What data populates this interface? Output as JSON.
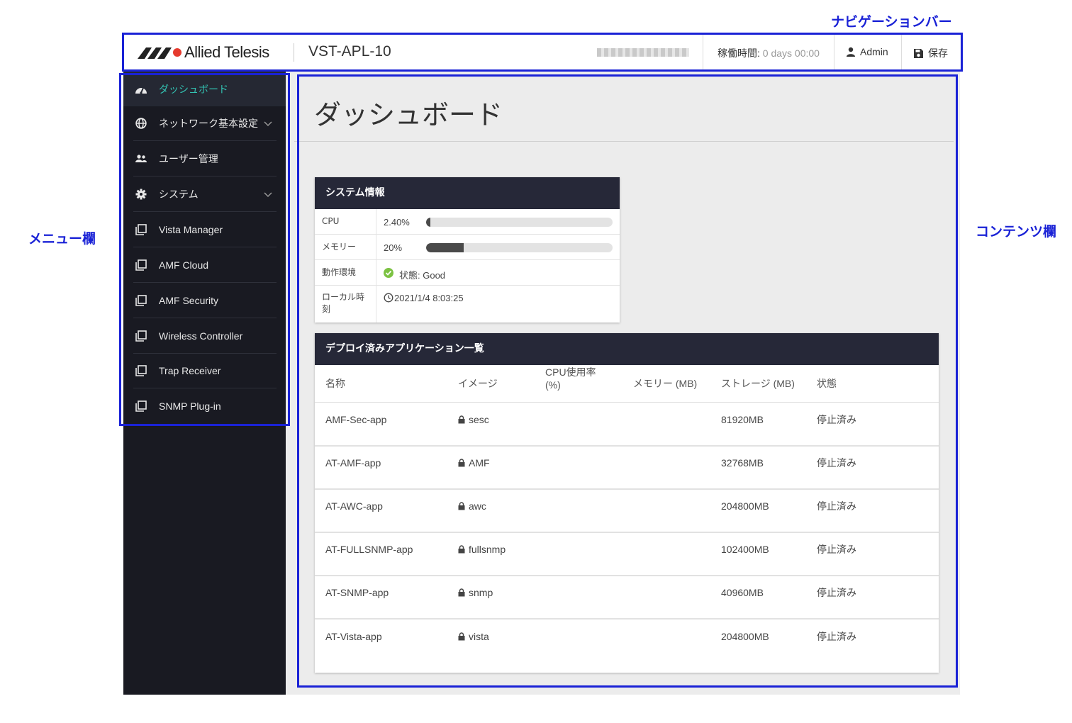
{
  "annotations": {
    "navbar_label": "ナビゲーションバー",
    "menu_label": "メニュー欄",
    "content_label": "コンテンツ欄",
    "color": "#1a22d6"
  },
  "navbar": {
    "brand": "Allied Telesis",
    "hostname": "VST-APL-10",
    "uptime_label": "稼働時間:",
    "uptime_value": " 0 days 00:00",
    "user": "Admin",
    "save": "保存"
  },
  "sidebar": {
    "accent": "#33c3b3",
    "items": [
      {
        "label": "ダッシュボード",
        "icon": "dashboard-icon",
        "active": true
      },
      {
        "label": "ネットワーク基本設定",
        "icon": "globe-icon",
        "expandable": true
      },
      {
        "label": "ユーザー管理",
        "icon": "users-icon"
      },
      {
        "label": "システム",
        "icon": "gear-icon",
        "expandable": true
      },
      {
        "label": "Vista Manager",
        "icon": "window-icon"
      },
      {
        "label": "AMF Cloud",
        "icon": "window-icon"
      },
      {
        "label": "AMF Security",
        "icon": "window-icon"
      },
      {
        "label": "Wireless Controller",
        "icon": "window-icon"
      },
      {
        "label": "Trap Receiver",
        "icon": "window-icon"
      },
      {
        "label": "SNMP Plug-in",
        "icon": "window-icon"
      }
    ]
  },
  "main": {
    "title": "ダッシュボード",
    "system_info": {
      "title": "システム情報",
      "cpu_label": "CPU",
      "cpu_value": "2.40%",
      "cpu_fraction": 0.024,
      "memory_label": "メモリー",
      "memory_value": "20%",
      "memory_fraction": 0.2,
      "env_label": "動作環境",
      "env_value": "状態: Good",
      "time_label_1": "ローカル時",
      "time_label_2": "刻",
      "time_value": "2021/1/4 8:03:25"
    },
    "apps": {
      "title": "デプロイ済みアプリケーション一覧",
      "columns": {
        "name": "名称",
        "image": "イメージ",
        "cpu_1": "CPU使用率",
        "cpu_2": "(%)",
        "memory": "メモリー (MB)",
        "storage": "ストレージ (MB)",
        "status": "状態"
      },
      "rows": [
        {
          "name": "AMF-Sec-app",
          "image": "sesc",
          "storage": "81920MB",
          "status": "停止済み"
        },
        {
          "name": "AT-AMF-app",
          "image": "AMF",
          "storage": "32768MB",
          "status": "停止済み"
        },
        {
          "name": "AT-AWC-app",
          "image": "awc",
          "storage": "204800MB",
          "status": "停止済み"
        },
        {
          "name": "AT-FULLSNMP-app",
          "image": "fullsnmp",
          "storage": "102400MB",
          "status": "停止済み"
        },
        {
          "name": "AT-SNMP-app",
          "image": "snmp",
          "storage": "40960MB",
          "status": "停止済み"
        },
        {
          "name": "AT-Vista-app",
          "image": "vista",
          "storage": "204800MB",
          "status": "停止済み"
        }
      ]
    }
  }
}
